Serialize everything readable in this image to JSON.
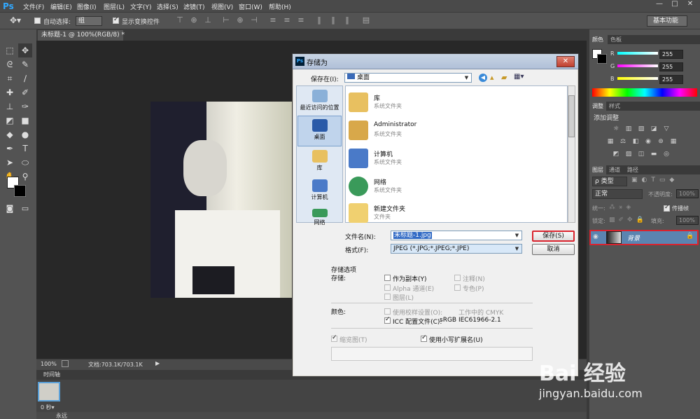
{
  "app": {
    "logo": "Ps"
  },
  "menu": [
    "文件(F)",
    "编辑(E)",
    "图像(I)",
    "图层(L)",
    "文字(Y)",
    "选择(S)",
    "滤镜(T)",
    "视图(V)",
    "窗口(W)",
    "帮助(H)"
  ],
  "window_controls": {
    "min": "—",
    "max": "□",
    "close": "✕"
  },
  "options": {
    "auto_select_label": "自动选择:",
    "auto_select_value": "组",
    "show_transform_label": "显示变换控件",
    "workspace": "基本功能"
  },
  "document": {
    "tab_title": "未标题-1 @ 100%(RGB/8) *",
    "zoom": "100%",
    "doc_size": "文档:703.1K/703.1K"
  },
  "timeline": {
    "tab": "时间轴",
    "frame_delay": "0 秒▾",
    "loop": "永远"
  },
  "right_panel": {
    "tab_color": "颜色",
    "tab_swatches": "色板",
    "r_label": "R",
    "g_label": "G",
    "b_label": "B",
    "r_value": "255",
    "g_value": "255",
    "b_value": "255",
    "tab_adjust": "调整",
    "tab_styles": "样式",
    "add_adjust": "添加调整",
    "tab_layers": "图层",
    "tab_channels": "通道",
    "tab_paths": "路径",
    "kind": "ρ 类型",
    "blend": "正常",
    "opacity_label": "不透明度:",
    "opacity_value": "100%",
    "unify_label": "统一:",
    "propagate": "传播帧",
    "lock_label": "锁定:",
    "fill_label": "填充:",
    "fill_value": "100%",
    "layer_name": "背景"
  },
  "dialog": {
    "title": "存储为",
    "save_in_label": "保存在(I):",
    "save_in_value": "桌面",
    "places": [
      "最近访问的位置",
      "桌面",
      "库",
      "计算机",
      "网络"
    ],
    "files": [
      {
        "name": "库",
        "sub": "系统文件夹"
      },
      {
        "name": "Administrator",
        "sub": "系统文件夹"
      },
      {
        "name": "计算机",
        "sub": "系统文件夹"
      },
      {
        "name": "网络",
        "sub": "系统文件夹"
      },
      {
        "name": "新建文件夹",
        "sub": "文件夹"
      }
    ],
    "filename_label": "文件名(N):",
    "filename_value": "未标题-1.jpg",
    "format_label": "格式(F):",
    "format_value": "JPEG (*.JPG;*.JPEG;*.JPE)",
    "save_button": "保存(S)",
    "cancel_button": "取消",
    "storage_options": "存储选项",
    "storage_label": "存储:",
    "as_copy": "作为副本(Y)",
    "notes": "注释(N)",
    "alpha": "Alpha 通道(E)",
    "spot": "专色(P)",
    "layers": "图层(L)",
    "color_label": "颜色:",
    "use_proof": "使用校样设置(O):",
    "proof_value": "工作中的 CMYK",
    "icc_label": "ICC 配置文件(C):",
    "icc_value": "sRGB IEC61966-2.1",
    "thumbnail": "缩览图(T)",
    "lowercase_ext": "使用小写扩展名(U)"
  },
  "watermark": {
    "brand": "Bai 经验",
    "url": "jingyan.baidu.com"
  }
}
